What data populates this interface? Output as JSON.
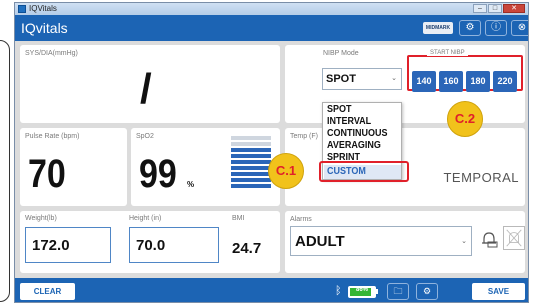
{
  "window": {
    "title": "IQVitals",
    "controls": [
      "–",
      "□",
      "✕"
    ]
  },
  "header": {
    "brand": "IQvitals",
    "logo_text": "MIDMARK"
  },
  "vitals": {
    "sys_dia": {
      "label": "SYS/DIA(mmHg)",
      "value": "/"
    },
    "pulse": {
      "label": "Pulse Rate (bpm)",
      "value": "70"
    },
    "spo2": {
      "label": "SpO2",
      "value": "99",
      "unit": "%",
      "bars_filled": 7,
      "bars_total": 9
    },
    "temp": {
      "label": "Temp (F)",
      "mode": "TEMPORAL"
    }
  },
  "nibp": {
    "label": "NIBP Mode",
    "selected": "SPOT",
    "options": [
      "SPOT",
      "INTERVAL",
      "CONTINUOUS",
      "AVERAGING",
      "SPRINT",
      "CUSTOM"
    ],
    "highlighted_option": "CUSTOM",
    "start_label": "START NIBP",
    "start_buttons": [
      "140",
      "160",
      "180",
      "220"
    ]
  },
  "measures": {
    "weight": {
      "label": "Weight(lb)",
      "value": "172.0"
    },
    "height": {
      "label": "Height (in)",
      "value": "70.0"
    },
    "bmi": {
      "label": "BMI",
      "value": "24.7"
    }
  },
  "alarms": {
    "label": "Alarms",
    "value": "ADULT"
  },
  "callouts": {
    "c1": "C.1",
    "c2": "C.2"
  },
  "footer": {
    "clear_label": "CLEAR",
    "save_label": "SAVE",
    "battery_text": "86%",
    "battery_level": 0.86
  },
  "colors": {
    "header_blue": "#1c64b4",
    "button_blue": "#2b66b8",
    "highlight_red": "#e0202a",
    "callout_yellow": "#f1c21b",
    "battery_green": "#35b535"
  },
  "icons": {
    "bluetooth": "bluetooth-icon",
    "folder": "folder-icon",
    "settings": "gear-icon",
    "info": "info-icon",
    "close": "close-icon",
    "alarm_bell": "bell-icon",
    "alarm_silence": "alarm-silence-icon"
  }
}
